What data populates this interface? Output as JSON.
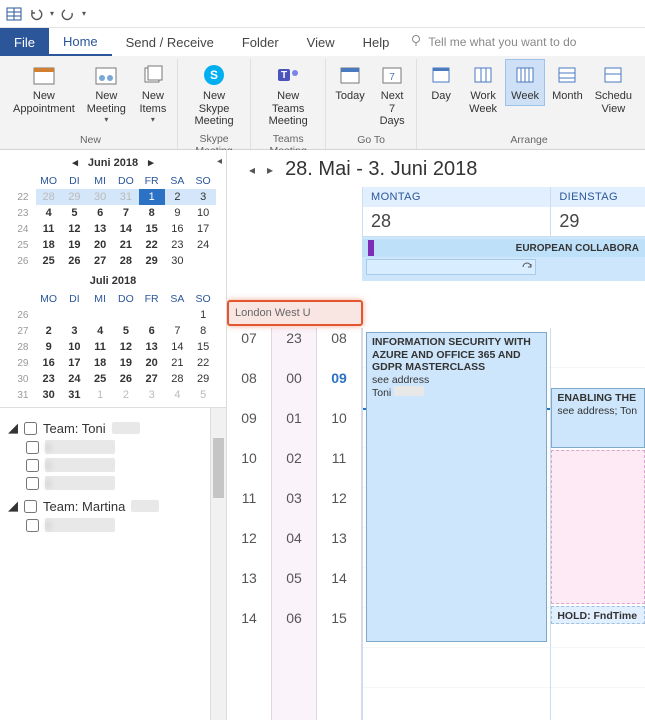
{
  "qat": {
    "icons": [
      "grid",
      "undo",
      "redo"
    ]
  },
  "tabs": {
    "file": "File",
    "home": "Home",
    "sendreceive": "Send / Receive",
    "folder": "Folder",
    "view": "View",
    "help": "Help",
    "tellme": "Tell me what you want to do"
  },
  "ribbon": {
    "new": {
      "appointment": "New\nAppointment",
      "meeting": "New\nMeeting",
      "items": "New\nItems",
      "label": "New"
    },
    "skype": {
      "btn": "New Skype\nMeeting",
      "label": "Skype Meeting"
    },
    "teams": {
      "btn": "New Teams\nMeeting",
      "label": "Teams Meeting"
    },
    "goto": {
      "today": "Today",
      "next7": "Next 7\nDays",
      "label": "Go To"
    },
    "arrange": {
      "day": "Day",
      "workweek": "Work\nWeek",
      "week": "Week",
      "month": "Month",
      "schedule": "Schedu\nView",
      "label": "Arrange"
    }
  },
  "minical1": {
    "title": "Juni 2018",
    "dow": [
      "MO",
      "DI",
      "MI",
      "DO",
      "FR",
      "SA",
      "SO"
    ],
    "rows": [
      {
        "wk": "22",
        "d": [
          "28",
          "29",
          "30",
          "31",
          "1",
          "2",
          "3"
        ],
        "range": [
          0,
          1,
          2,
          3,
          4,
          5,
          6
        ],
        "today": 4,
        "dim": [
          0,
          1,
          2,
          3
        ]
      },
      {
        "wk": "23",
        "d": [
          "4",
          "5",
          "6",
          "7",
          "8",
          "9",
          "10"
        ],
        "bold": [
          0,
          1,
          2,
          3,
          4
        ]
      },
      {
        "wk": "24",
        "d": [
          "11",
          "12",
          "13",
          "14",
          "15",
          "16",
          "17"
        ],
        "bold": [
          0,
          1,
          2,
          3,
          4
        ]
      },
      {
        "wk": "25",
        "d": [
          "18",
          "19",
          "20",
          "21",
          "22",
          "23",
          "24"
        ],
        "bold": [
          0,
          1,
          2,
          3,
          4
        ]
      },
      {
        "wk": "26",
        "d": [
          "25",
          "26",
          "27",
          "28",
          "29",
          "30",
          ""
        ],
        "bold": [
          0,
          1,
          2,
          3,
          4
        ]
      }
    ]
  },
  "minical2": {
    "title": "Juli 2018",
    "dow": [
      "MO",
      "DI",
      "MI",
      "DO",
      "FR",
      "SA",
      "SO"
    ],
    "rows": [
      {
        "wk": "26",
        "d": [
          "",
          "",
          "",
          "",
          "",
          "",
          "1"
        ]
      },
      {
        "wk": "27",
        "d": [
          "2",
          "3",
          "4",
          "5",
          "6",
          "7",
          "8"
        ],
        "bold": [
          0,
          1,
          2,
          3,
          4
        ]
      },
      {
        "wk": "28",
        "d": [
          "9",
          "10",
          "11",
          "12",
          "13",
          "14",
          "15"
        ],
        "bold": [
          0,
          1,
          2,
          3,
          4
        ]
      },
      {
        "wk": "29",
        "d": [
          "16",
          "17",
          "18",
          "19",
          "20",
          "21",
          "22"
        ],
        "bold": [
          0,
          1,
          2,
          3,
          4
        ]
      },
      {
        "wk": "30",
        "d": [
          "23",
          "24",
          "25",
          "26",
          "27",
          "28",
          "29"
        ],
        "bold": [
          0,
          1,
          2,
          3,
          4
        ]
      },
      {
        "wk": "31",
        "d": [
          "30",
          "31",
          "1",
          "2",
          "3",
          "4",
          "5"
        ],
        "dim": [
          2,
          3,
          4,
          5,
          6
        ],
        "bold": [
          0,
          1
        ]
      }
    ]
  },
  "calgroups": [
    {
      "name": "Team: Toni",
      "items": [
        "redacted",
        "redacted",
        "redacted"
      ]
    },
    {
      "name": "Team: Martina",
      "items": [
        "redacted"
      ]
    }
  ],
  "range_title": "28. Mai - 3. Juni 2018",
  "days": [
    {
      "name": "MONTAG",
      "num": "28"
    },
    {
      "name": "DIENSTAG",
      "num": "29"
    }
  ],
  "allday_event": "EUROPEAN COLLABORA",
  "highlight_text": "London West U",
  "timecols": [
    [
      "07",
      "08",
      "09",
      "10",
      "11",
      "12",
      "13",
      "14"
    ],
    [
      "23",
      "00",
      "01",
      "02",
      "03",
      "04",
      "05",
      "06"
    ],
    [
      "08",
      "09",
      "10",
      "11",
      "12",
      "13",
      "14",
      "15"
    ]
  ],
  "events": {
    "monday": {
      "title": "INFORMATION SECURITY WITH AZURE AND OFFICE 365 AND GDPR MASTERCLASS",
      "sub1": "see address",
      "sub2": "Toni"
    },
    "tuesday": {
      "e1_title": "ENABLING THE",
      "e1_sub": "see address; Ton",
      "e2_title": "HOLD: FndTime"
    }
  }
}
